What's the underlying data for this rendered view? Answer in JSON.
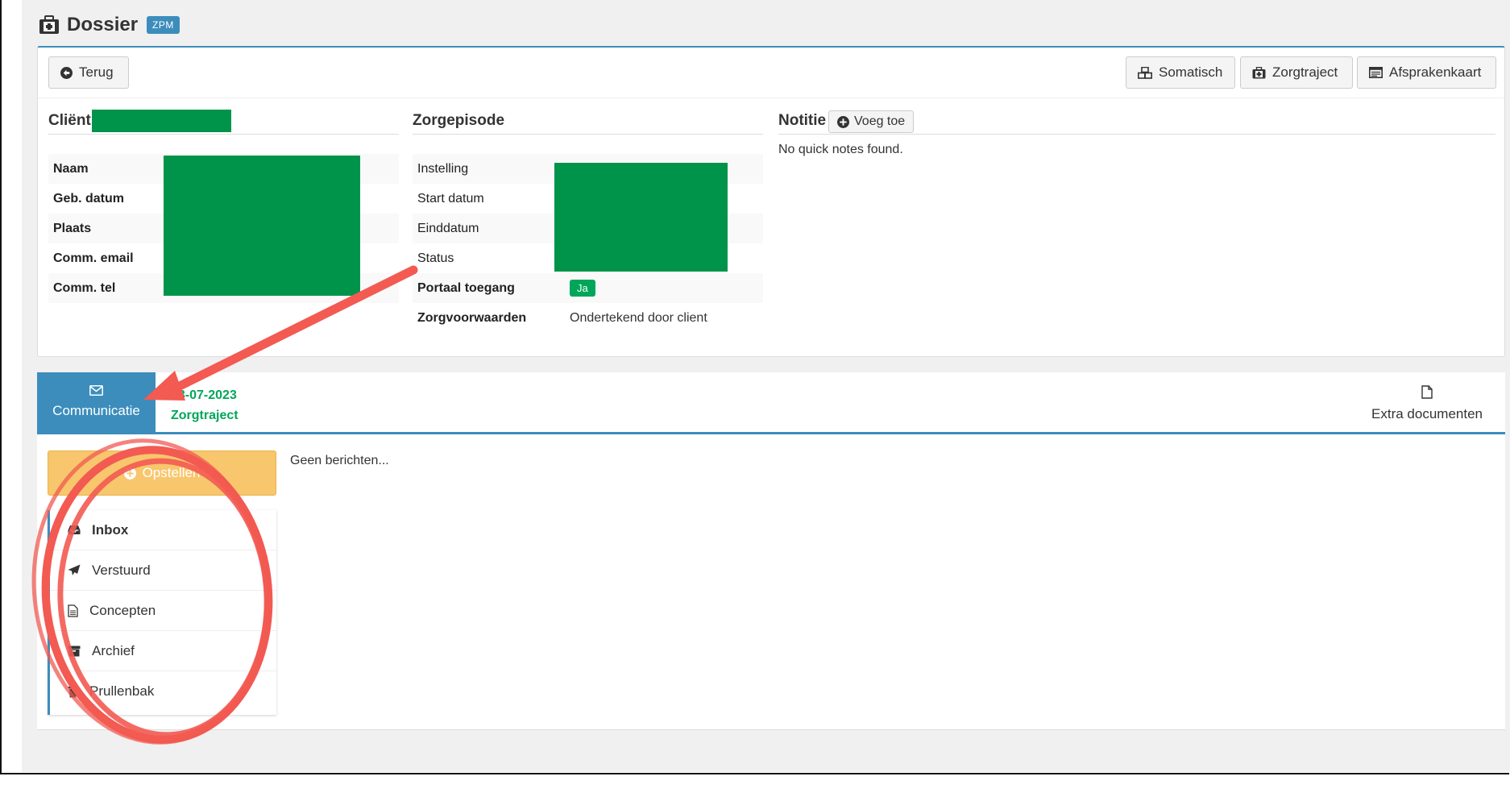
{
  "header": {
    "title": "Dossier",
    "badge": "ZPM"
  },
  "toolbar": {
    "back_label": "Terug",
    "somatisch_label": "Somatisch",
    "zorgtraject_label": "Zorgtraject",
    "afsprakenkaart_label": "Afsprakenkaart"
  },
  "client": {
    "title": "Cliënt",
    "rows": [
      {
        "label": "Naam"
      },
      {
        "label": "Geb. datum"
      },
      {
        "label": "Plaats"
      },
      {
        "label": "Comm. email"
      },
      {
        "label": "Comm. tel"
      }
    ]
  },
  "zorgepisode": {
    "title": "Zorgepisode",
    "rows": [
      {
        "label": "Instelling",
        "value": ""
      },
      {
        "label": "Start datum",
        "value": ""
      },
      {
        "label": "Einddatum",
        "value": ""
      },
      {
        "label": "Status",
        "value": ""
      },
      {
        "label": "Portaal toegang",
        "value": "Ja"
      },
      {
        "label": "Zorgvoorwaarden",
        "value": "Ondertekend door client"
      }
    ]
  },
  "notitie": {
    "title": "Notitie",
    "add_label": "Voeg toe",
    "empty_text": "No quick notes found."
  },
  "tabs": {
    "communicatie": "Communicatie",
    "zorg_date": "18-07-2023",
    "zorg_label": "Zorgtraject",
    "extra": "Extra documenten"
  },
  "messages": {
    "compose_label": "Opstellen",
    "empty_text": "Geen berichten...",
    "folders": [
      {
        "label": "Inbox"
      },
      {
        "label": "Verstuurd"
      },
      {
        "label": "Concepten"
      },
      {
        "label": "Archief"
      },
      {
        "label": "Prullenbak"
      }
    ]
  },
  "colors": {
    "primary": "#3c8dbc",
    "success": "#00a65a",
    "warning": "#f8c66c",
    "redaction": "#00944a",
    "annotation": "#f25a52"
  }
}
